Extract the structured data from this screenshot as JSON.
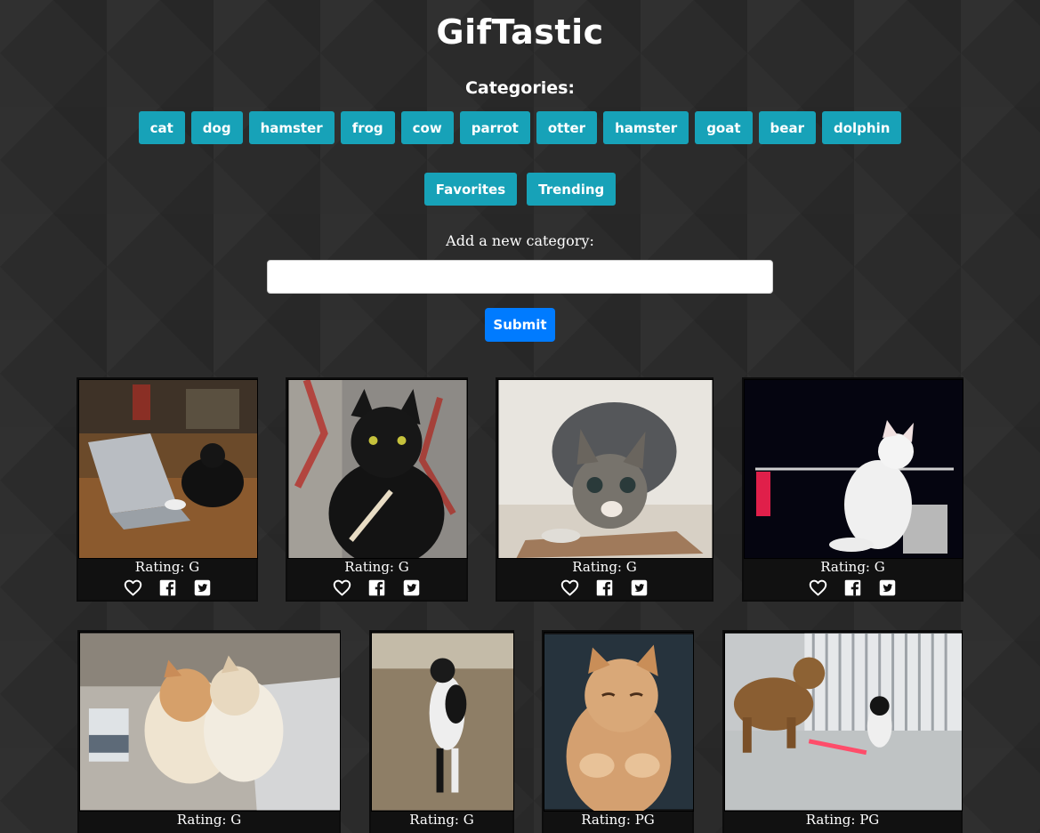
{
  "title": "GifTastic",
  "categories_heading": "Categories:",
  "categories": [
    "cat",
    "dog",
    "hamster",
    "frog",
    "cow",
    "parrot",
    "otter",
    "hamster",
    "goat",
    "bear",
    "dolphin"
  ],
  "extra_buttons": {
    "favorites": "Favorites",
    "trending": "Trending"
  },
  "add_label": "Add a new category:",
  "new_category": {
    "value": "",
    "placeholder": ""
  },
  "submit_label": "Submit",
  "colors": {
    "category_button": "#17a2b8",
    "submit_button": "#007bff",
    "background": "#2b2b2b"
  },
  "gifs": [
    {
      "rating": "Rating: G",
      "icons": [
        "heart-icon",
        "facebook-icon",
        "twitter-icon"
      ],
      "image": "cat typing on laptop"
    },
    {
      "rating": "Rating: G",
      "icons": [
        "heart-icon",
        "facebook-icon",
        "twitter-icon"
      ],
      "image": "black cat with nail file"
    },
    {
      "rating": "Rating: G",
      "icons": [
        "heart-icon",
        "facebook-icon",
        "twitter-icon"
      ],
      "image": "tabby cat crouching"
    },
    {
      "rating": "Rating: G",
      "icons": [
        "heart-icon",
        "facebook-icon",
        "twitter-icon"
      ],
      "image": "white cat on bar"
    },
    {
      "rating": "Rating: G",
      "icons": [
        "heart-icon",
        "facebook-icon",
        "twitter-icon"
      ],
      "image": "two fluffy kittens hugging"
    },
    {
      "rating": "Rating: G",
      "icons": [
        "heart-icon",
        "facebook-icon",
        "twitter-icon"
      ],
      "image": "cat standing upright"
    },
    {
      "rating": "Rating: PG",
      "icons": [
        "heart-icon",
        "facebook-icon",
        "twitter-icon"
      ],
      "image": "orange kitten dozing"
    },
    {
      "rating": "Rating: PG",
      "icons": [
        "heart-icon",
        "facebook-icon",
        "twitter-icon"
      ],
      "image": "cat with lightsaber and dog"
    }
  ]
}
